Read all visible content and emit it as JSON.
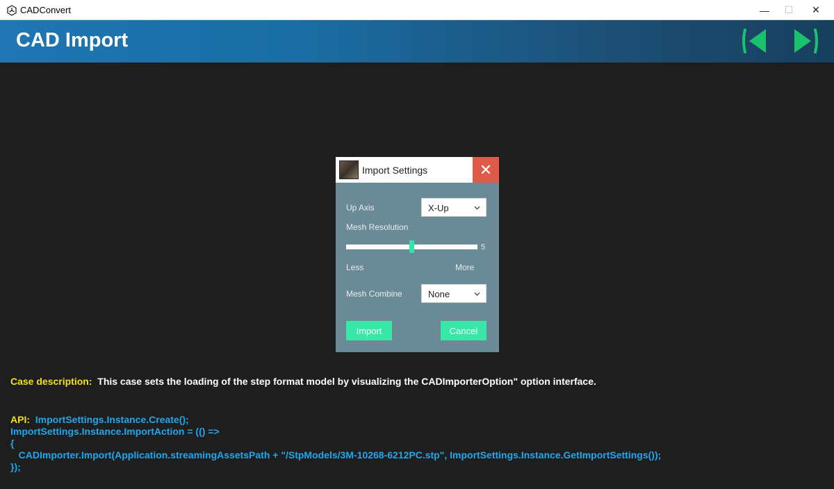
{
  "window": {
    "title": "CADConvert",
    "icon": "unity-logo-icon",
    "controls": {
      "minimize": "—",
      "maximize": "☐",
      "close": "✕"
    }
  },
  "header": {
    "title": "CAD Import",
    "prev_icon": "prev-arrow-icon",
    "next_icon": "next-arrow-icon",
    "arrow_color": "#19c36b"
  },
  "dialog": {
    "title": "Import Settings",
    "close_glyph": "✕",
    "up_axis": {
      "label": "Up Axis",
      "value": "X-Up"
    },
    "mesh_resolution": {
      "label": "Mesh Resolution",
      "value": "5",
      "min_label": "Less",
      "max_label": "More",
      "level": 0.5
    },
    "mesh_combine": {
      "label": "Mesh Combine",
      "value": "None"
    },
    "import_label": "Import",
    "cancel_label": "Cancel",
    "accent": "#37e8a8"
  },
  "description": {
    "label": "Case description:",
    "text": "This case sets the loading of the step format model by visualizing the CADImporterOption\" option interface."
  },
  "api": {
    "label": "API:",
    "lines": [
      "ImportSettings.Instance.Create();",
      "ImportSettings.Instance.ImportAction = (() =>",
      "{",
      "   CADImporter.Import(Application.streamingAssetsPath + \"/StpModels/3M-10268-6212PC.stp\", ImportSettings.Instance.GetImportSettings());",
      "});"
    ]
  }
}
